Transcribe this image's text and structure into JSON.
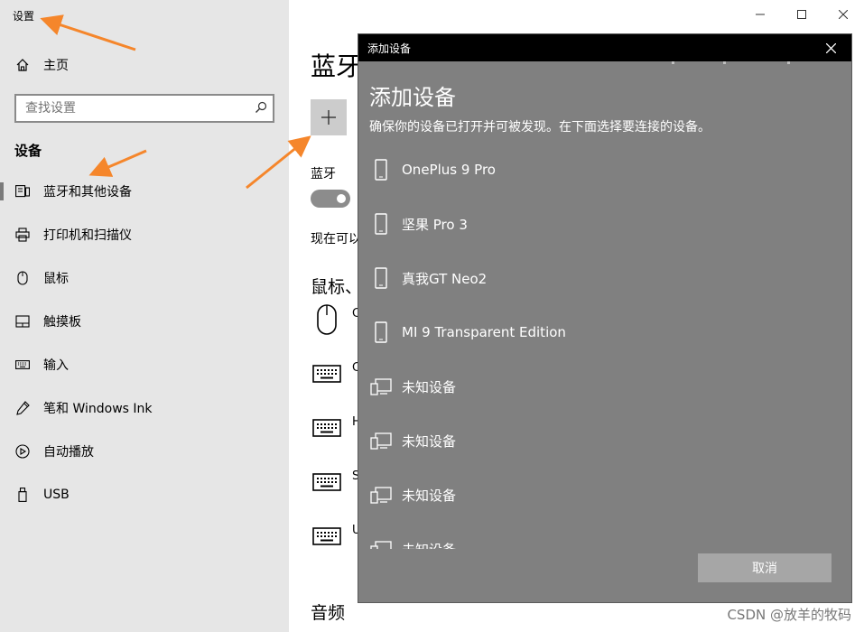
{
  "window": {
    "title": "设置"
  },
  "sidebar": {
    "home_label": "主页",
    "search_placeholder": "查找设置",
    "section_title": "设备",
    "items": [
      {
        "label": "蓝牙和其他设备",
        "icon": "bluetooth-devices-icon",
        "selected": true
      },
      {
        "label": "打印机和扫描仪",
        "icon": "printer-icon"
      },
      {
        "label": "鼠标",
        "icon": "mouse-icon"
      },
      {
        "label": "触摸板",
        "icon": "touchpad-icon"
      },
      {
        "label": "输入",
        "icon": "keyboard-icon"
      },
      {
        "label": "笔和 Windows Ink",
        "icon": "pen-icon"
      },
      {
        "label": "自动播放",
        "icon": "autoplay-icon"
      },
      {
        "label": "USB",
        "icon": "usb-icon"
      }
    ]
  },
  "main": {
    "page_title_partial": "蓝牙",
    "bluetooth_label": "蓝牙",
    "discoverable_partial": "现在可以",
    "mouse_keyboard_heading_partial": "鼠标、",
    "device_letters": [
      "C",
      "H",
      "S",
      "U"
    ],
    "audio_heading": "音频"
  },
  "dialog": {
    "titlebar": "添加设备",
    "heading": "添加设备",
    "instruction": "确保你的设备已打开并可被发现。在下面选择要连接的设备。",
    "devices": [
      {
        "name": "OnePlus 9 Pro",
        "icon": "phone-icon"
      },
      {
        "name": "坚果 Pro 3",
        "icon": "phone-icon"
      },
      {
        "name": "真我GT Neo2",
        "icon": "phone-icon"
      },
      {
        "name": "MI 9 Transparent Edition",
        "icon": "phone-icon"
      },
      {
        "name": "未知设备",
        "icon": "unknown-device-icon"
      },
      {
        "name": "未知设备",
        "icon": "unknown-device-icon"
      },
      {
        "name": "未知设备",
        "icon": "unknown-device-icon"
      },
      {
        "name": "未知设备",
        "icon": "unknown-device-icon"
      }
    ],
    "cancel_label": "取消"
  },
  "watermark": "CSDN @放羊的牧码",
  "colors": {
    "sidebar_bg": "#e6e6e6",
    "dialog_bg": "#808080",
    "dialog_titlebar": "#000000",
    "annotation_arrow": "#f5862b"
  }
}
